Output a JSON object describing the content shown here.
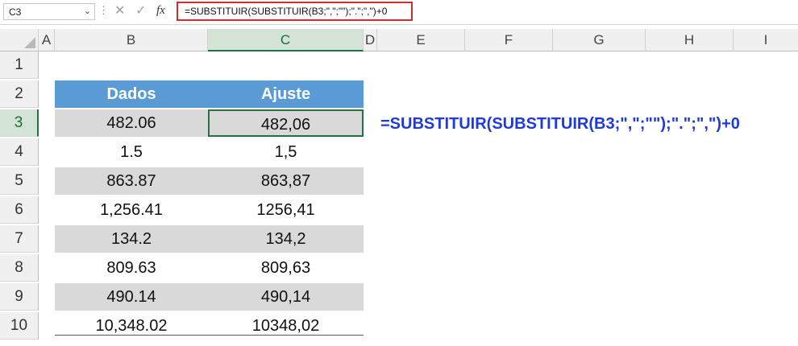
{
  "name_box": {
    "value": "C3",
    "arrow_icon": "chevron-down-icon"
  },
  "formula_bar": {
    "formula": "=SUBSTITUIR(SUBSTITUIR(B3;\",\";\"\");\".\";\",\")+0",
    "cancel_icon": "cancel-icon",
    "enter_icon": "check-icon",
    "fx_label": "fx",
    "border_color": "#d62b2b"
  },
  "columns": [
    "A",
    "B",
    "C",
    "D",
    "E",
    "F",
    "G",
    "H",
    "I"
  ],
  "active_column": "C",
  "rows": [
    "1",
    "2",
    "3",
    "4",
    "5",
    "6",
    "7",
    "8",
    "9",
    "10"
  ],
  "active_row": "3",
  "table": {
    "headers": [
      "Dados",
      "Ajuste"
    ],
    "header_color": "#5b9bd5",
    "band_color": "#d9d9d9",
    "rows": [
      [
        "482.06",
        "482,06"
      ],
      [
        "1.5",
        "1,5"
      ],
      [
        "863.87",
        "863,87"
      ],
      [
        "1,256.41",
        "1256,41"
      ],
      [
        "134.2",
        "134,2"
      ],
      [
        "809.63",
        "809,63"
      ],
      [
        "490.14",
        "490,14"
      ],
      [
        "10,348.02",
        "10348,02"
      ]
    ]
  },
  "annotation": {
    "text": "=SUBSTITUIR(SUBSTITUIR(B3;\",\";\"\");\".\";\",\")+0",
    "color": "#1f3bd6"
  }
}
